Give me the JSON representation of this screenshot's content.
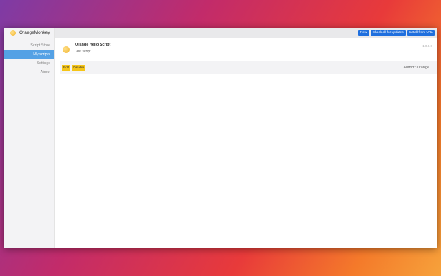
{
  "app": {
    "name": "OrangeMonkey"
  },
  "sidebar": {
    "items": [
      {
        "label": "Script Store",
        "active": false
      },
      {
        "label": "My scripts",
        "active": true
      },
      {
        "label": "Settings",
        "active": false
      },
      {
        "label": "About",
        "active": false
      }
    ]
  },
  "toolbar": {
    "new_label": "New",
    "check_updates_label": "Check all for updates",
    "install_url_label": "Install from URL"
  },
  "script": {
    "name": "Orange Hello Script",
    "description": "Test script",
    "meta": "1.0.0.0",
    "edit_label": "Edit",
    "disable_label": "Disable",
    "author": "Author: Orange"
  },
  "colors": {
    "accent": "#54a1e5",
    "button_blue": "#1f6fde",
    "button_yellow": "#f5c518"
  }
}
